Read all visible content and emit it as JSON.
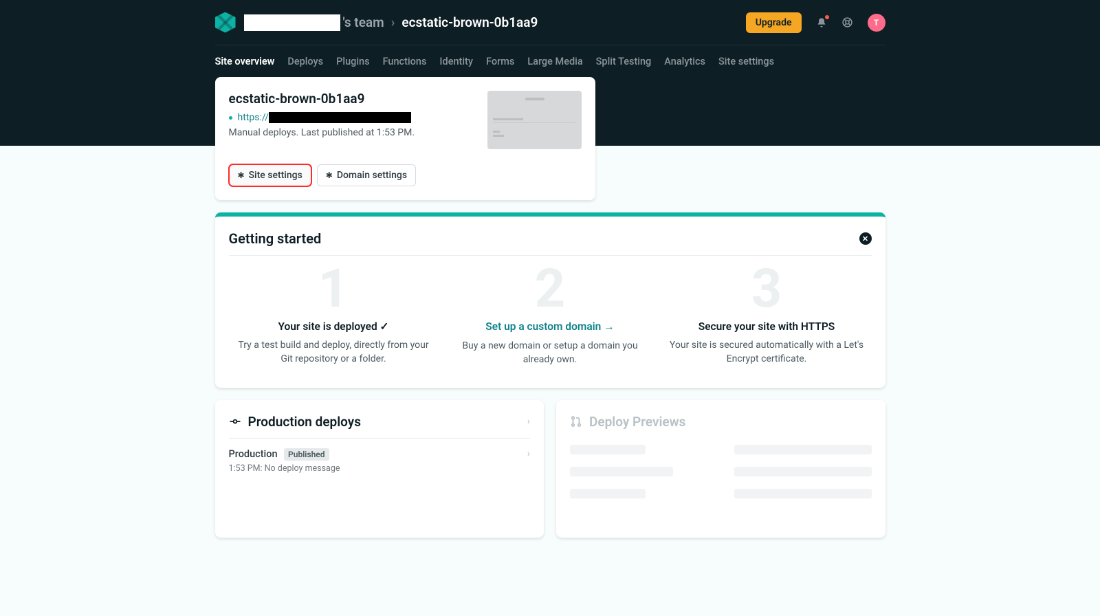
{
  "header": {
    "team_suffix": "'s team",
    "separator": "›",
    "site_name": "ecstatic-brown-0b1aa9",
    "upgrade": "Upgrade",
    "avatar_initial": "T"
  },
  "tabs": [
    {
      "label": "Site overview",
      "active": true
    },
    {
      "label": "Deploys"
    },
    {
      "label": "Plugins"
    },
    {
      "label": "Functions"
    },
    {
      "label": "Identity"
    },
    {
      "label": "Forms"
    },
    {
      "label": "Large Media"
    },
    {
      "label": "Split Testing"
    },
    {
      "label": "Analytics"
    },
    {
      "label": "Site settings"
    }
  ],
  "site_card": {
    "title": "ecstatic-brown-0b1aa9",
    "url_prefix": "https://",
    "meta": "Manual deploys. Last published at 1:53 PM.",
    "site_settings_btn": "Site settings",
    "domain_settings_btn": "Domain settings"
  },
  "getting_started": {
    "title": "Getting started",
    "steps": {
      "1": {
        "num": "1",
        "title": "Your site is deployed ✓",
        "desc": "Try a test build and deploy, directly from your Git repository or a folder."
      },
      "2": {
        "num": "2",
        "title": "Set up a custom domain →",
        "desc": "Buy a new domain or setup a domain you already own."
      },
      "3": {
        "num": "3",
        "title": "Secure your site with HTTPS",
        "desc": "Your site is secured automatically with a Let's Encrypt certificate."
      }
    }
  },
  "production": {
    "title": "Production deploys",
    "row": {
      "env": "Production",
      "badge": "Published",
      "sub": "1:53 PM: No deploy message"
    }
  },
  "previews": {
    "title": "Deploy Previews"
  }
}
